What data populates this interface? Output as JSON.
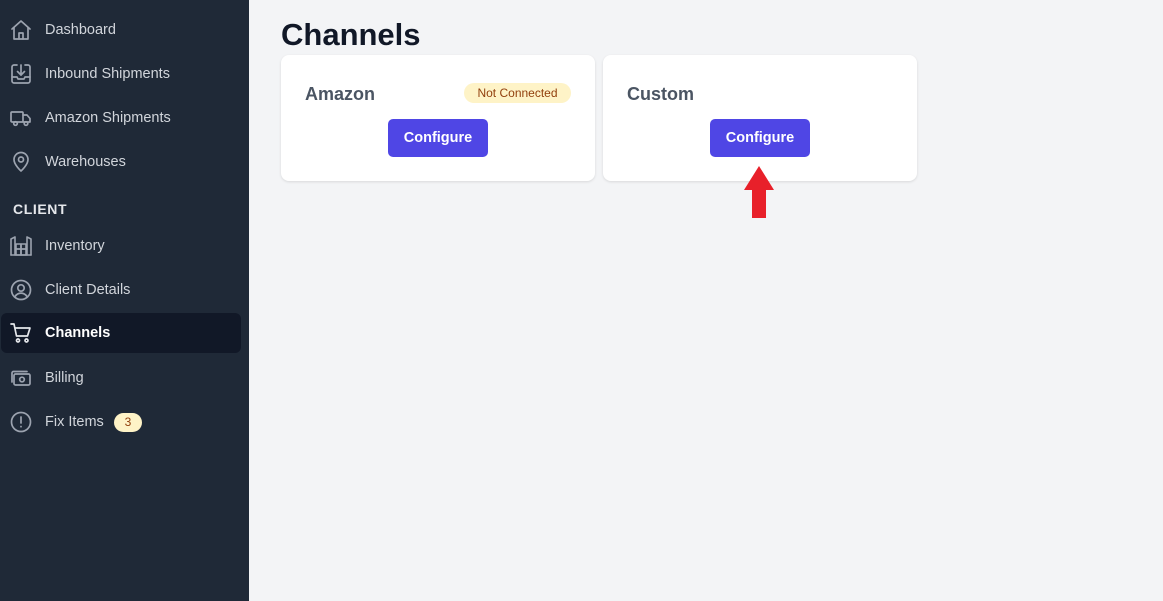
{
  "sidebar": {
    "items": [
      {
        "label": "Dashboard",
        "icon": "home-icon"
      },
      {
        "label": "Inbound Shipments",
        "icon": "inbox-download-icon"
      },
      {
        "label": "Amazon Shipments",
        "icon": "truck-icon"
      },
      {
        "label": "Warehouses",
        "icon": "map-pin-icon"
      }
    ],
    "section_label": "CLIENT",
    "client_items": [
      {
        "label": "Inventory",
        "icon": "warehouse-shelves-icon"
      },
      {
        "label": "Client Details",
        "icon": "user-circle-icon"
      },
      {
        "label": "Channels",
        "icon": "shopping-cart-icon",
        "active": true
      },
      {
        "label": "Billing",
        "icon": "cash-icon"
      },
      {
        "label": "Fix Items",
        "icon": "exclamation-circle-icon",
        "badge": "3"
      }
    ]
  },
  "main": {
    "title": "Channels",
    "channels": [
      {
        "name": "Amazon",
        "status": "Not Connected",
        "button_label": "Configure"
      },
      {
        "name": "Custom",
        "button_label": "Configure"
      }
    ]
  },
  "colors": {
    "sidebar_bg": "#1f2937",
    "active_bg": "#111827",
    "accent": "#4f46e5",
    "badge_bg": "#fef3c7",
    "annotation_arrow": "#e8202a"
  }
}
